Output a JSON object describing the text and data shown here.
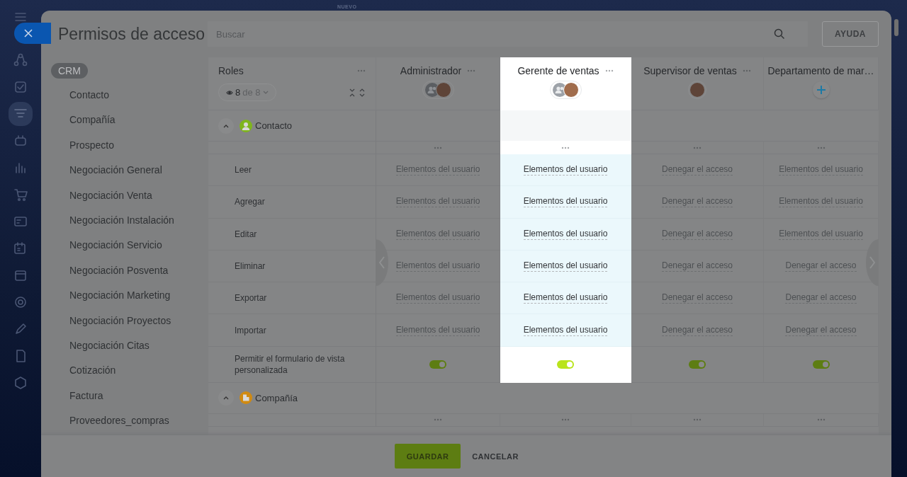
{
  "top_label": "NUEVO",
  "nav": {
    "items": [
      {
        "selected": false
      },
      {
        "selected": false
      },
      {
        "selected": false
      },
      {
        "selected": true
      },
      {
        "selected": false
      },
      {
        "selected": false
      },
      {
        "selected": false
      },
      {
        "selected": false
      },
      {
        "selected": false
      },
      {
        "selected": false
      },
      {
        "selected": false
      },
      {
        "selected": false
      },
      {
        "selected": false
      },
      {
        "selected": false
      }
    ]
  },
  "dialog": {
    "title": "Permisos de acceso",
    "search": {
      "placeholder": "Buscar"
    },
    "help_button": "AYUDA"
  },
  "sidebar": {
    "group": "CRM",
    "items": [
      "Contacto",
      "Compañía",
      "Prospecto",
      "Negociación General",
      "Negociación Venta",
      "Negociación Instalación",
      "Negociación Servicio",
      "Negociación Posventa",
      "Negociación Marketing",
      "Negociación Proyectos",
      "Negociación Citas",
      "Cotización",
      "Factura",
      "Proveedores_compras"
    ]
  },
  "table": {
    "roles_header": {
      "label": "Roles",
      "filter_count": "8",
      "filter_total": "de 8"
    },
    "columns": [
      {
        "name": "Administrador",
        "highlighted": false,
        "more_menu": true,
        "kind": "group_and_user"
      },
      {
        "name": "Gerente de ventas",
        "highlighted": true,
        "more_menu": true,
        "kind": "group_and_user"
      },
      {
        "name": "Supervisor de ventas",
        "highlighted": false,
        "more_menu": true,
        "kind": "user"
      },
      {
        "name": "Departamento de mar…",
        "highlighted": false,
        "more_menu": false,
        "kind": "add"
      }
    ],
    "sections": [
      {
        "title": "Contacto",
        "kind": "contact",
        "color": "#7fb51c",
        "expanded": true,
        "highlighted": true,
        "rows": [
          {
            "label": "Leer",
            "kind": "select",
            "values": [
              "Elementos del usuario",
              "Elementos del usuario",
              "Denegar el acceso",
              "Elementos del usuario"
            ]
          },
          {
            "label": "Agregar",
            "kind": "select",
            "values": [
              "Elementos del usuario",
              "Elementos del usuario",
              "Denegar el acceso",
              "Elementos del usuario"
            ]
          },
          {
            "label": "Editar",
            "kind": "select",
            "values": [
              "Elementos del usuario",
              "Elementos del usuario",
              "Denegar el acceso",
              "Elementos del usuario"
            ]
          },
          {
            "label": "Eliminar",
            "kind": "select",
            "values": [
              "Elementos del usuario",
              "Elementos del usuario",
              "Denegar el acceso",
              "Denegar el acceso"
            ]
          },
          {
            "label": "Exportar",
            "kind": "select",
            "values": [
              "Elementos del usuario",
              "Elementos del usuario",
              "Denegar el acceso",
              "Denegar el acceso"
            ]
          },
          {
            "label": "Importar",
            "kind": "select",
            "values": [
              "Elementos del usuario",
              "Elementos del usuario",
              "Denegar el acceso",
              "Denegar el acceso"
            ]
          },
          {
            "label": "Permitir el formulario de vista personalizada",
            "kind": "toggle",
            "values": [
              {
                "on": true
              },
              {
                "on": true
              },
              {
                "on": true
              },
              {
                "on": true
              }
            ]
          }
        ]
      },
      {
        "title": "Compañía",
        "kind": "company",
        "color": "#d08a12",
        "expanded": true,
        "highlighted": false
      }
    ]
  },
  "footer": {
    "save_button": "GUARDAR",
    "cancel_button": "CANCELAR"
  }
}
